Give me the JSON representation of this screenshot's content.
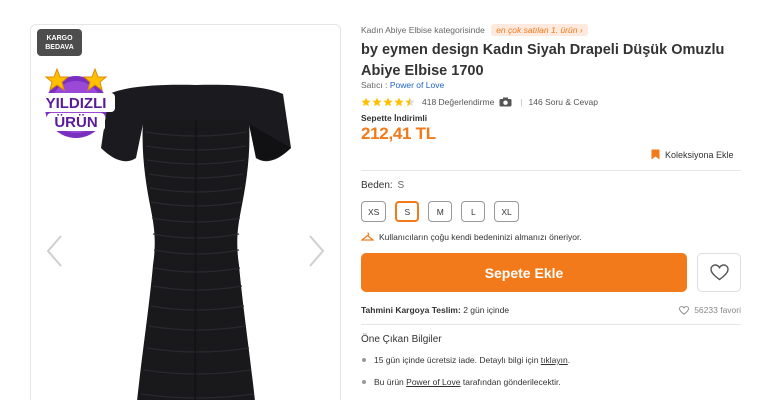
{
  "gallery": {
    "cargo_badge": "KARGO BEDAVA",
    "star_badge_line1": "YILDIZLI",
    "star_badge_line2": "ÜRÜN"
  },
  "product": {
    "category_text": "Kadın Abiye Elbise kategorisinde",
    "best_seller_badge": "en çok satılan 1. ürün",
    "brand": "by eymen design",
    "title": "Kadın Siyah Drapeli Düşük Omuzlu Abiye Elbise 1700",
    "seller_label": "Satıcı :",
    "seller_name": "Power of Love",
    "rating_count": "418 Değerlendirme",
    "qa_count": "146 Soru & Cevap",
    "rating_value": 4.5,
    "discount_label": "Sepette İndirimli",
    "price": "212,41 TL",
    "collection_label": "Koleksiyona Ekle"
  },
  "size": {
    "label": "Beden:",
    "selected": "S",
    "options": [
      "XS",
      "S",
      "M",
      "L",
      "XL"
    ],
    "fit_note": "Kullanıcıların çoğu kendi bedeninizi almanızı öneriyor."
  },
  "actions": {
    "add_to_cart": "Sepete Ekle"
  },
  "delivery": {
    "label": "Tahmini Kargoya Teslim:",
    "value": "2 gün içinde",
    "favorites": "56233 favori"
  },
  "highlights": {
    "title": "Öne Çıkan Bilgiler",
    "item1_text": "15 gün içinde ücretsiz iade. Detaylı bilgi için",
    "item1_link": "tıklayın",
    "item1_end": ".",
    "item2_prefix": "Bu ürün",
    "item2_link": "Power of Love",
    "item2_suffix": "tarafından gönderilecektir."
  },
  "colors": {
    "accent": "#f27a1a",
    "link": "#1e62c9",
    "badge_purple": "#7b2fbf",
    "star_gold": "#ffc000"
  }
}
